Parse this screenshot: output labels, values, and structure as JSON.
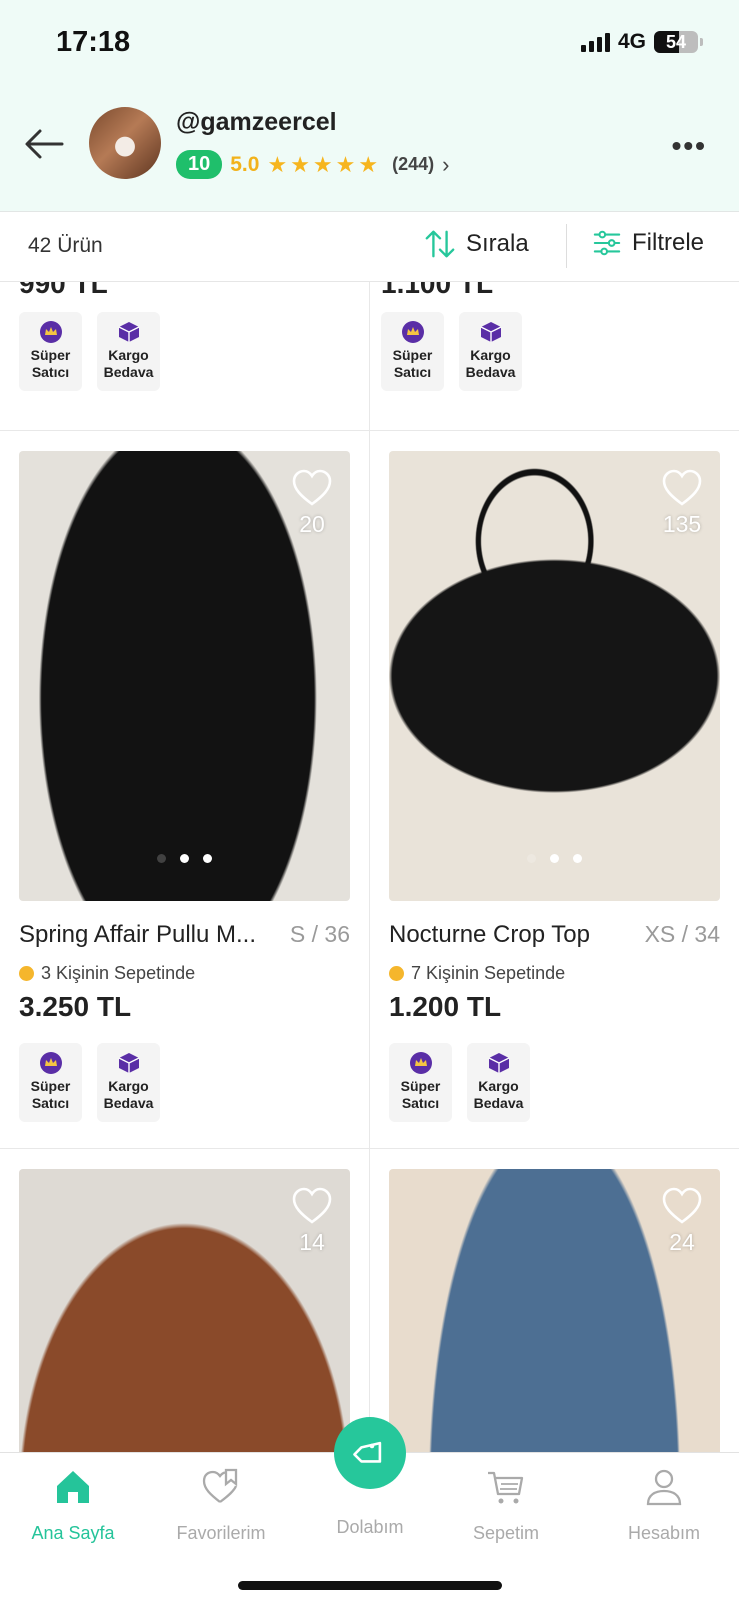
{
  "status": {
    "time": "17:18",
    "network": "4G",
    "battery": "54"
  },
  "profile": {
    "username": "@gamzeercel",
    "level": "10",
    "score": "5.0",
    "stars": 5,
    "review_count": "(244)"
  },
  "toolbar": {
    "total": "42 Ürün",
    "sort_label": "Sırala",
    "filter_label": "Filtrele"
  },
  "badges": {
    "super_seller": "Süper\nSatıcı",
    "free_shipping": "Kargo\nBedava"
  },
  "top_row": [
    {
      "price": "990 TL"
    },
    {
      "price": "1.100 TL"
    }
  ],
  "products": [
    {
      "title": "Spring Affair Pullu M...",
      "size": "S / 36",
      "likes": "20",
      "basket": "3 Kişinin Sepetinde",
      "price": "3.250 TL"
    },
    {
      "title": "Nocturne Crop Top",
      "size": "XS / 34",
      "likes": "135",
      "basket": "7 Kişinin Sepetinde",
      "price": "1.200 TL"
    },
    {
      "title": "",
      "size": "",
      "likes": "14",
      "basket": "",
      "price": ""
    },
    {
      "title": "",
      "size": "",
      "likes": "24",
      "basket": "",
      "price": ""
    }
  ],
  "nav": {
    "home": "Ana Sayfa",
    "favorites": "Favorilerim",
    "closet": "Dolabım",
    "cart": "Sepetim",
    "account": "Hesabım"
  },
  "colors": {
    "brand": "#26c79b",
    "header_bg": "#effbf7",
    "level_badge": "#1fbf6b",
    "star": "#f6b51e",
    "badge_icon": "#5a2ea6"
  }
}
